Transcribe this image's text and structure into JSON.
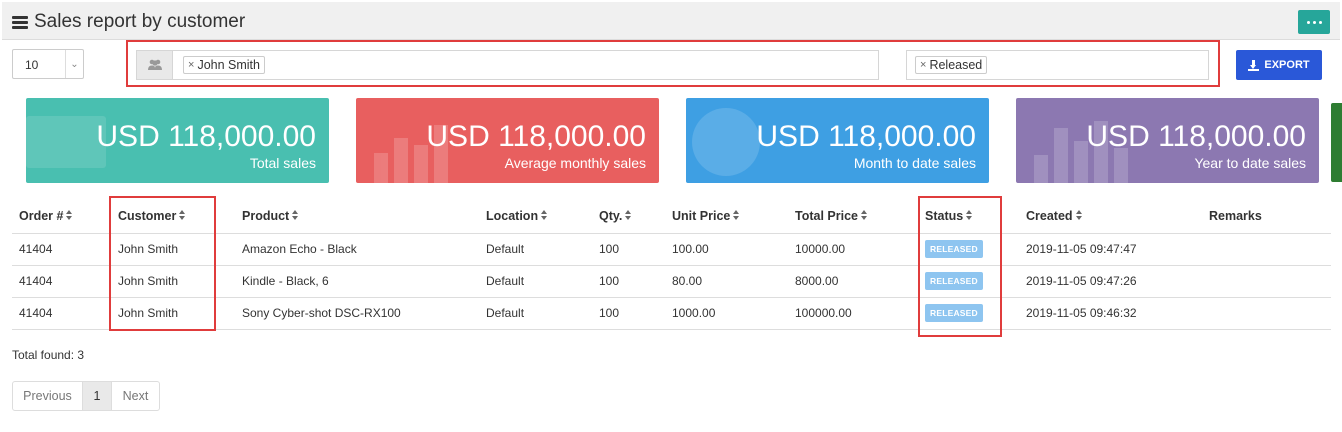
{
  "header": {
    "title": "Sales report by customer",
    "title_icon": "list-icon",
    "menu_icon": "ellipsis-icon"
  },
  "page_size": {
    "value": "10"
  },
  "filters": {
    "customer_icon": "users-icon",
    "customer_tag": "John Smith",
    "status_tag": "Released"
  },
  "export": {
    "label": "EXPORT",
    "icon": "download-icon"
  },
  "cards": [
    {
      "value": "USD 118,000.00",
      "label": "Total sales",
      "color": "#49bfb0"
    },
    {
      "value": "USD 118,000.00",
      "label": "Average monthly sales",
      "color": "#e85f5f"
    },
    {
      "value": "USD 118,000.00",
      "label": "Month to date sales",
      "color": "#3e9fe3"
    },
    {
      "value": "USD 118,000.00",
      "label": "Year to date sales",
      "color": "#8c78b1"
    }
  ],
  "table": {
    "headers": [
      "Order #",
      "Customer",
      "Product",
      "Location",
      "Qty.",
      "Unit Price",
      "Total Price",
      "Status",
      "Created",
      "Remarks"
    ],
    "rows": [
      {
        "order": "41404",
        "customer": "John Smith",
        "product": "Amazon Echo - Black",
        "location": "Default",
        "qty": "100",
        "unit_price": "100.00",
        "total_price": "10000.00",
        "status": "RELEASED",
        "created": "2019-11-05 09:47:47",
        "remarks": ""
      },
      {
        "order": "41404",
        "customer": "John Smith",
        "product": "Kindle - Black, 6",
        "location": "Default",
        "qty": "100",
        "unit_price": "80.00",
        "total_price": "8000.00",
        "status": "RELEASED",
        "created": "2019-11-05 09:47:26",
        "remarks": ""
      },
      {
        "order": "41404",
        "customer": "John Smith",
        "product": "Sony Cyber-shot DSC-RX100",
        "location": "Default",
        "qty": "100",
        "unit_price": "1000.00",
        "total_price": "100000.00",
        "status": "RELEASED",
        "created": "2019-11-05 09:46:32",
        "remarks": ""
      }
    ]
  },
  "total_found": "Total found: 3",
  "pagination": {
    "prev": "Previous",
    "current": "1",
    "next": "Next"
  },
  "colors": {
    "accent": "#26a69a",
    "export": "#2a58d8",
    "highlight": "#e03c3c",
    "badge": "#8ec5f0"
  }
}
